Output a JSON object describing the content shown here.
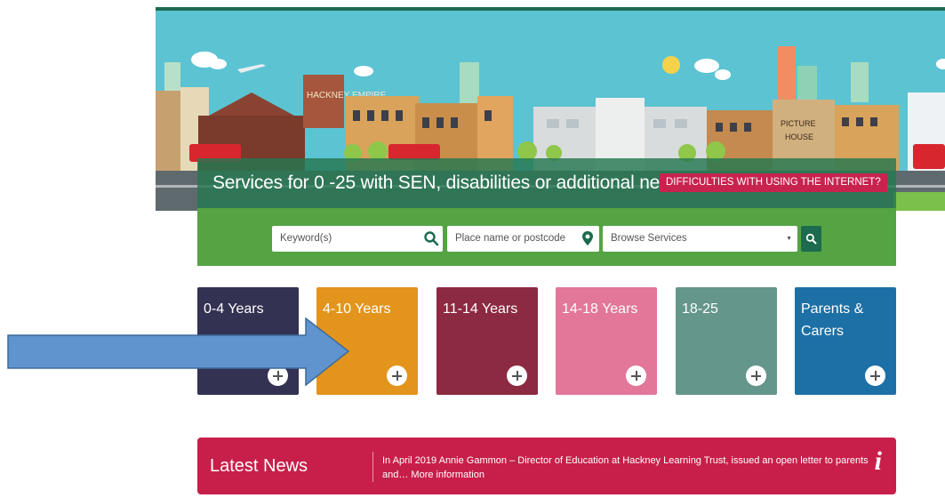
{
  "banner": {
    "title": "Services for 0 -25 with SEN, disabilities or additional needs",
    "help_link": "DIFFICULTIES WITH USING THE INTERNET?",
    "signs": {
      "empire": "HACKNEY EMPIRE",
      "picture": "PICTURE",
      "house": "HOUSE"
    }
  },
  "search": {
    "keyword_placeholder": "Keyword(s)",
    "place_placeholder": "Place name or postcode",
    "browse_selected": "Browse Services"
  },
  "tiles": [
    {
      "label": "0-4 Years",
      "color": "#343252"
    },
    {
      "label": "4-10 Years",
      "color": "#e3941c"
    },
    {
      "label": "11-14 Years",
      "color": "#8c2a41"
    },
    {
      "label": "14-18 Years",
      "color": "#e27799"
    },
    {
      "label": "18-25",
      "color": "#65968c"
    },
    {
      "label": "Parents & Carers",
      "color": "#1d70a6"
    }
  ],
  "news": {
    "title": "Latest News",
    "text": "In April 2019 Annie Gammon – Director of Education at Hackney Learning Trust, issued an open letter to parents and… More information"
  },
  "colors": {
    "green_dark": "#1d6b4f",
    "green_band": "#54a443",
    "news": "#c81f4a",
    "arrow": "#5f94cf",
    "sky": "#5cc3d3"
  },
  "icons": [
    "search-icon",
    "location-pin-icon",
    "plus-icon",
    "info-icon",
    "arrow-annotation"
  ]
}
